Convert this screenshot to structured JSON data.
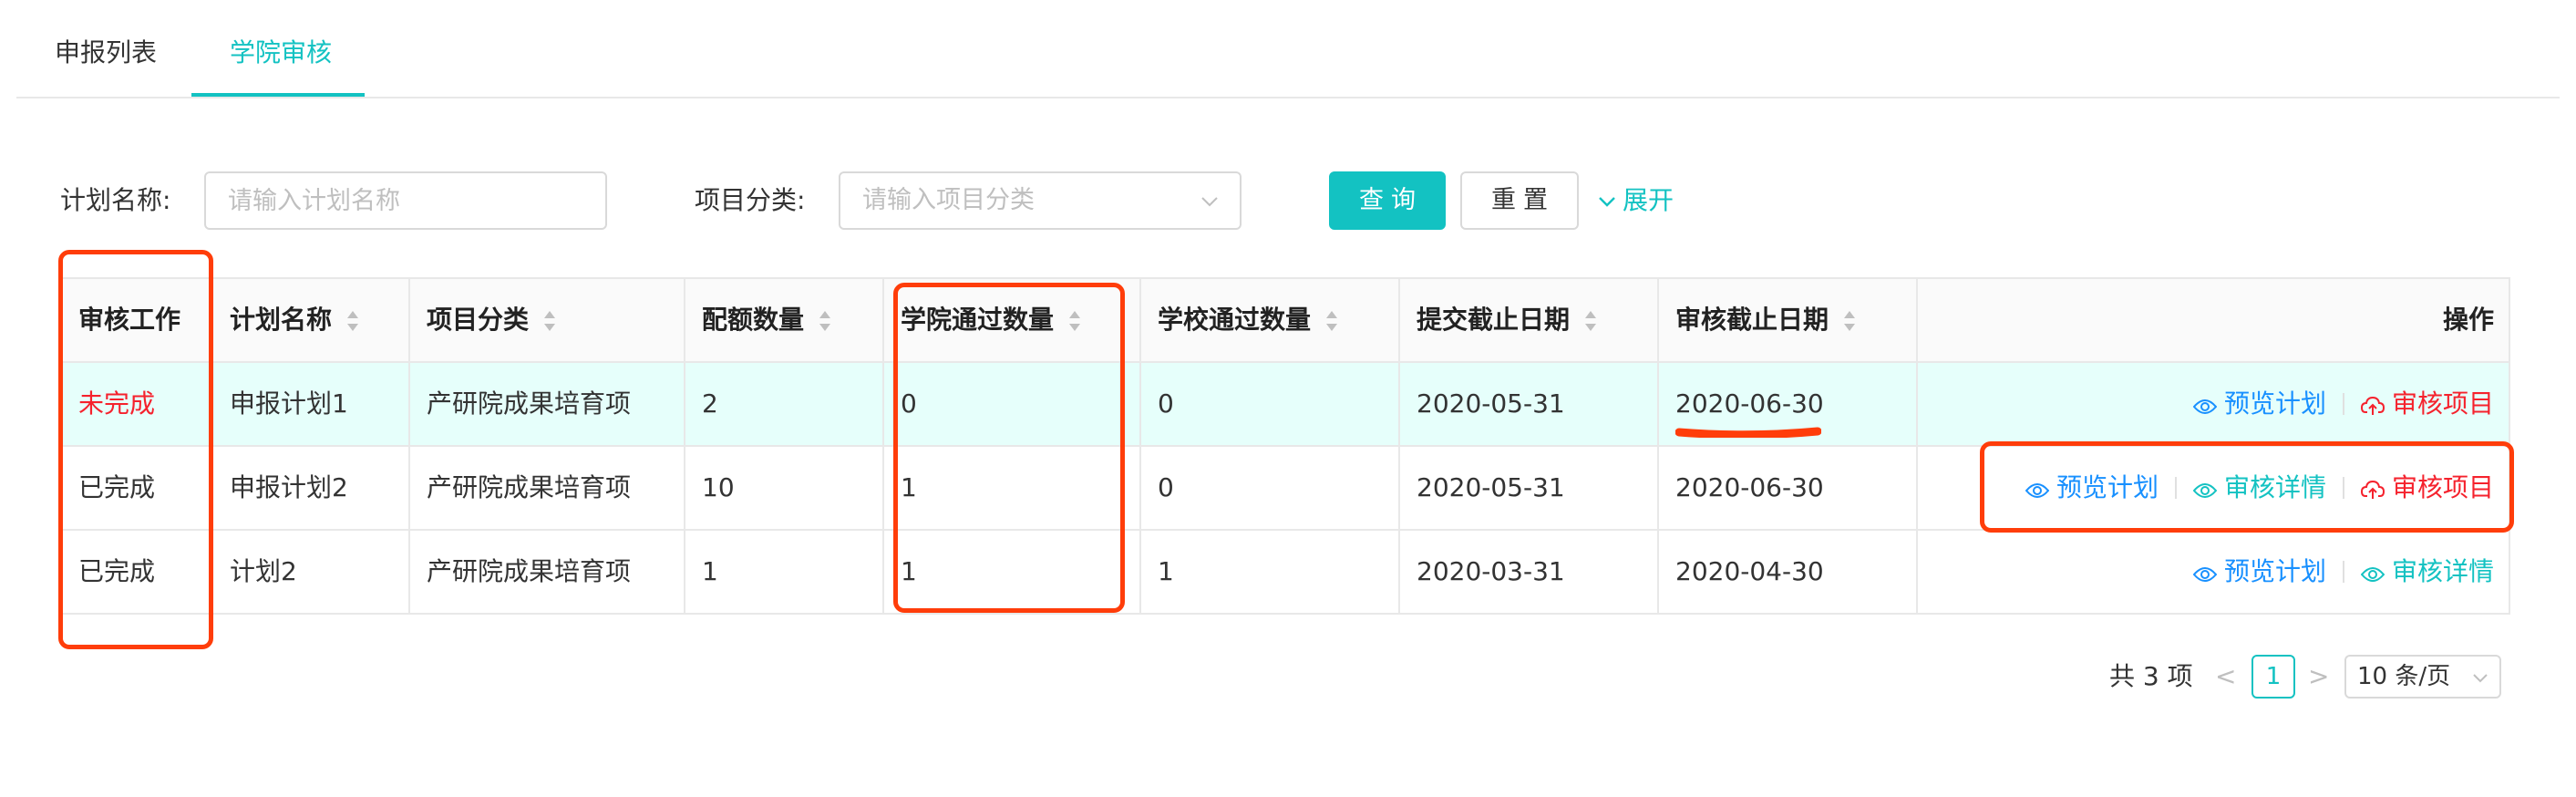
{
  "tabs": [
    {
      "label": "申报列表",
      "active": false
    },
    {
      "label": "学院审核",
      "active": true
    }
  ],
  "filter": {
    "plan_name_label": "计划名称:",
    "plan_name_placeholder": "请输入计划名称",
    "category_label": "项目分类:",
    "category_placeholder": "请输入项目分类",
    "query_button": "查询",
    "reset_button": "重置",
    "expand_label": "展开"
  },
  "table": {
    "headers": [
      "审核工作",
      "计划名称",
      "项目分类",
      "配额数量",
      "学院通过数量",
      "学校通过数量",
      "提交截止日期",
      "审核截止日期",
      "操作"
    ],
    "rows": [
      {
        "status": "未完成",
        "plan": "申报计划1",
        "category": "产研院成果培育项",
        "quota": "2",
        "college_pass": "0",
        "school_pass": "0",
        "submit_deadline": "2020-05-31",
        "review_deadline": "2020-06-30",
        "actions": [
          "预览计划",
          "审核项目"
        ]
      },
      {
        "status": "已完成",
        "plan": "申报计划2",
        "category": "产研院成果培育项",
        "quota": "10",
        "college_pass": "1",
        "school_pass": "0",
        "submit_deadline": "2020-05-31",
        "review_deadline": "2020-06-30",
        "actions": [
          "预览计划",
          "审核详情",
          "审核项目"
        ]
      },
      {
        "status": "已完成",
        "plan": "计划2",
        "category": "产研院成果培育项",
        "quota": "1",
        "college_pass": "1",
        "school_pass": "1",
        "submit_deadline": "2020-03-31",
        "review_deadline": "2020-04-30",
        "actions": [
          "预览计划",
          "审核详情"
        ]
      }
    ]
  },
  "pagination": {
    "total": "共 3 项",
    "current_page": "1",
    "page_size": "10 条/页"
  },
  "colors": {
    "primary": "#13c2c2",
    "link_blue": "#1890ff",
    "danger": "#f5222d",
    "annotation": "#ff3d0a"
  }
}
